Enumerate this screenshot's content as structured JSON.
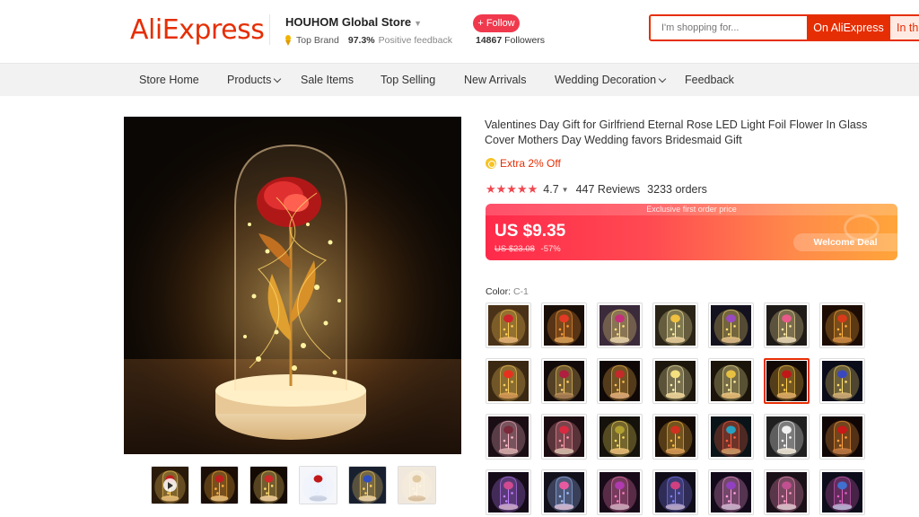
{
  "header": {
    "logo": "AliExpress",
    "store_name": "HOUHOM Global Store",
    "top_brand": "Top Brand",
    "positive_pct": "97.3%",
    "positive_label": "Positive feedback",
    "follow_label": "+ Follow",
    "followers_count": "14867",
    "followers_label": "Followers",
    "search_placeholder": "I'm shopping for...",
    "search_on_ali": "On AliExpress",
    "search_in_store": "In this store"
  },
  "nav": {
    "items": [
      {
        "label": "Store Home"
      },
      {
        "label": "Products"
      },
      {
        "label": "Sale Items"
      },
      {
        "label": "Top Selling"
      },
      {
        "label": "New Arrivals"
      },
      {
        "label": "Wedding Decoration"
      },
      {
        "label": "Feedback"
      }
    ]
  },
  "product": {
    "title": "Valentines Day Gift for Girlfriend Eternal Rose LED Light Foil Flower In Glass Cover Mothers Day Wedding favors Bridesmaid Gift",
    "extra_off": "Extra 2% Off",
    "stars": "★★★★★",
    "rating": "4.7",
    "reviews": "447 Reviews",
    "orders": "3233 orders",
    "price_tag": "Exclusive first order price",
    "price": "US $9.35",
    "old_price": "US $23.08",
    "discount": "-57%",
    "welcome_deal": "Welcome Deal",
    "color_label": "Color:",
    "color_value": "C-1"
  },
  "colors": {
    "accent": "#e62e04",
    "follow": "#f0394d",
    "star": "#f04850"
  },
  "thumbnails": [
    {
      "kind": "video"
    },
    {
      "kind": "photo"
    },
    {
      "kind": "photo"
    },
    {
      "kind": "photo"
    },
    {
      "kind": "photo"
    },
    {
      "kind": "photo"
    }
  ],
  "swatches": [
    {
      "flower": "#d0242c",
      "light": "#ffcc55",
      "bg": "#4a3218",
      "base": "#d9a870"
    },
    {
      "flower": "#e23a24",
      "light": "#ff9c3a",
      "bg": "#1a0e08",
      "base": "#c8924f"
    },
    {
      "flower": "#c4307a",
      "light": "#ffe27a",
      "bg": "#3a2a3a",
      "base": "#d8c4a0"
    },
    {
      "flower": "#f0c040",
      "light": "#fff2a0",
      "bg": "#2a2418",
      "base": "#d8c090"
    },
    {
      "flower": "#9a4ac0",
      "light": "#ffe070",
      "bg": "#14121e",
      "base": "#d0b080"
    },
    {
      "flower": "#e85a8a",
      "light": "#ffe8a0",
      "bg": "#1e1a18",
      "base": "#d8c8a8"
    },
    {
      "flower": "#d83a1a",
      "light": "#ffb040",
      "bg": "#1c0c04",
      "base": "#c08040"
    },
    {
      "flower": "#e8301e",
      "light": "#ffd060",
      "bg": "#3a2812",
      "base": "#c89050"
    },
    {
      "flower": "#b01e40",
      "light": "#ffd26a",
      "bg": "#120a0a",
      "base": "#a07850"
    },
    {
      "flower": "#c42a2a",
      "light": "#ffc050",
      "bg": "#100806",
      "base": "#d0a070"
    },
    {
      "flower": "#f4e080",
      "light": "#fff4b0",
      "bg": "#1c160c",
      "base": "#e0c890"
    },
    {
      "flower": "#e8c040",
      "light": "#fff0a0",
      "bg": "#1a140a",
      "base": "#d8b070"
    },
    {
      "flower": "#c01818",
      "light": "#ffcc50",
      "bg": "#120806",
      "base": "#d0a060"
    },
    {
      "flower": "#3a48c0",
      "light": "#ffe070",
      "bg": "#0a0c1a",
      "base": "#c0a070"
    },
    {
      "flower": "#7a2a3a",
      "light": "#ffb8c8",
      "bg": "#1a0e14",
      "base": "#c8a0a0"
    },
    {
      "flower": "#d82a40",
      "light": "#ff9aa8",
      "bg": "#1a0c10",
      "base": "#c8b0a0"
    },
    {
      "flower": "#b0a030",
      "light": "#ffe060",
      "bg": "#14120a",
      "base": "#d8b070"
    },
    {
      "flower": "#d03020",
      "light": "#ffc040",
      "bg": "#140a06",
      "base": "#c89050"
    },
    {
      "flower": "#28a0c0",
      "light": "#ff6040",
      "bg": "#0a1418",
      "base": "#c09060"
    },
    {
      "flower": "#f0f0f0",
      "light": "#ffffff",
      "bg": "#202020",
      "base": "#e0d8c8"
    },
    {
      "flower": "#c81818",
      "light": "#ffa040",
      "bg": "#100606",
      "base": "#b07040"
    },
    {
      "flower": "#d04a90",
      "light": "#c080ff",
      "bg": "#140a18",
      "base": "#c0a0c0"
    },
    {
      "flower": "#e85aa0",
      "light": "#a0c0ff",
      "bg": "#12101a",
      "base": "#c8b0c8"
    },
    {
      "flower": "#b03ab0",
      "light": "#ff80c0",
      "bg": "#180a18",
      "base": "#c0a0b0"
    },
    {
      "flower": "#d04080",
      "light": "#8080ff",
      "bg": "#100c18",
      "base": "#b0a0c0"
    },
    {
      "flower": "#9040c0",
      "light": "#ffa0e0",
      "bg": "#120a1a",
      "base": "#c0a8c0"
    },
    {
      "flower": "#c05090",
      "light": "#ff9ac8",
      "bg": "#1a1018",
      "base": "#d0b8c0"
    },
    {
      "flower": "#4070d0",
      "light": "#e060c0",
      "bg": "#0c0c1a",
      "base": "#b0a8c8"
    }
  ],
  "selected_swatch_index": 12
}
